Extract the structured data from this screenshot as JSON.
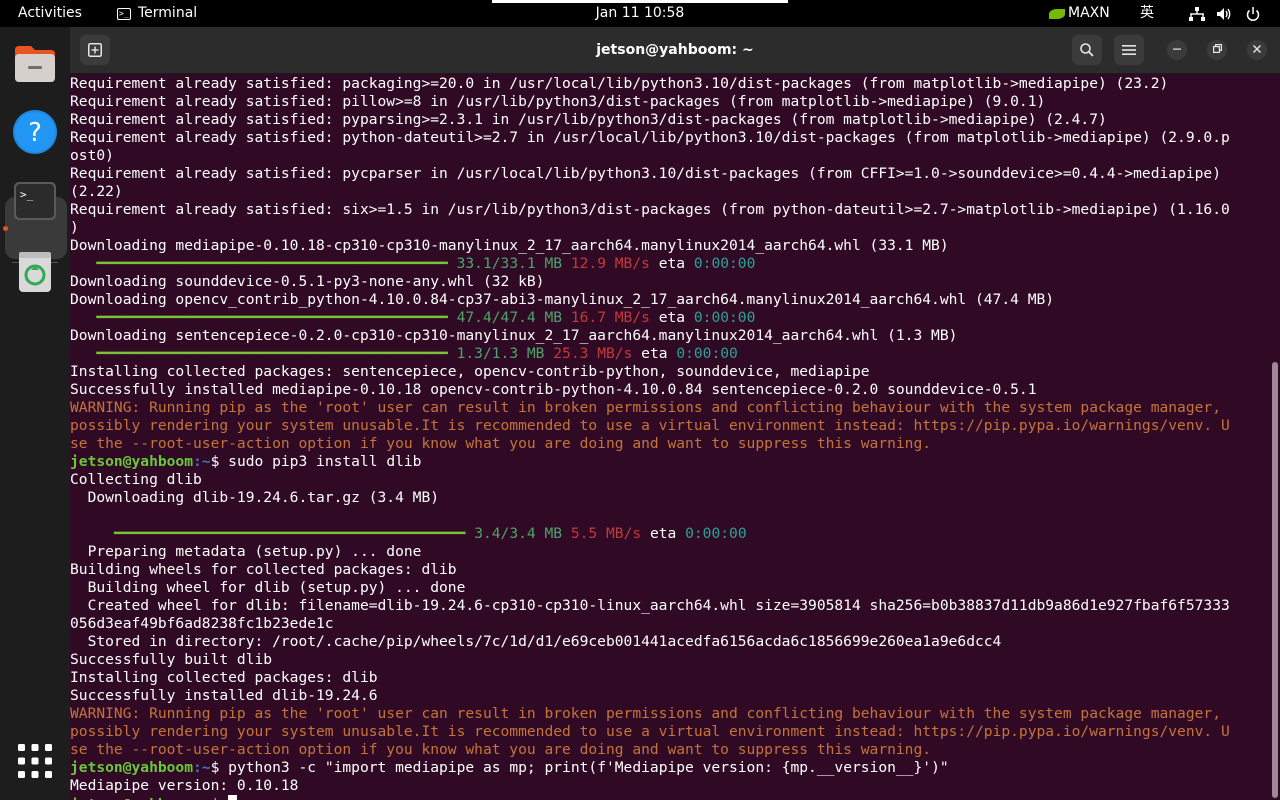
{
  "topbar": {
    "activities": "Activities",
    "app_name": "Terminal",
    "clock": "Jan 11  10:58",
    "power_mode": "MAXN",
    "input_method": "英"
  },
  "dock": {
    "items": [
      "files-icon",
      "help-icon",
      "terminal-icon",
      "trash-icon",
      "app-grid-icon"
    ]
  },
  "window": {
    "title": "jetson@yahboom: ~"
  },
  "terminal": {
    "lines": [
      {
        "t": "Requirement already satisfied: packaging>=20.0 in /usr/local/lib/python3.10/dist-packages (from matplotlib->mediapipe) (23.2)"
      },
      {
        "t": "Requirement already satisfied: pillow>=8 in /usr/lib/python3/dist-packages (from matplotlib->mediapipe) (9.0.1)"
      },
      {
        "t": "Requirement already satisfied: pyparsing>=2.3.1 in /usr/lib/python3/dist-packages (from matplotlib->mediapipe) (2.4.7)"
      },
      {
        "t": "Requirement already satisfied: python-dateutil>=2.7 in /usr/local/lib/python3.10/dist-packages (from matplotlib->mediapipe) (2.9.0.p"
      },
      {
        "t": "ost0)"
      },
      {
        "t": "Requirement already satisfied: pycparser in /usr/local/lib/python3.10/dist-packages (from CFFI>=1.0->sounddevice>=0.4.4->mediapipe)"
      },
      {
        "t": "(2.22)"
      },
      {
        "t": "Requirement already satisfied: six>=1.5 in /usr/lib/python3/dist-packages (from python-dateutil>=2.7->matplotlib->mediapipe) (1.16.0"
      },
      {
        "t": ")"
      },
      {
        "t": "Downloading mediapipe-0.10.18-cp310-cp310-manylinux_2_17_aarch64.manylinux2014_aarch64.whl (33.1 MB)"
      },
      {
        "progress": {
          "indent": "   ",
          "size": "33.1/33.1 MB",
          "speed": "12.9 MB/s",
          "eta_label": "eta",
          "eta": "0:00:00"
        }
      },
      {
        "t": "Downloading sounddevice-0.5.1-py3-none-any.whl (32 kB)"
      },
      {
        "t": "Downloading opencv_contrib_python-4.10.0.84-cp37-abi3-manylinux_2_17_aarch64.manylinux2014_aarch64.whl (47.4 MB)"
      },
      {
        "progress": {
          "indent": "   ",
          "size": "47.4/47.4 MB",
          "speed": "16.7 MB/s",
          "eta_label": "eta",
          "eta": "0:00:00"
        }
      },
      {
        "t": "Downloading sentencepiece-0.2.0-cp310-cp310-manylinux_2_17_aarch64.manylinux2014_aarch64.whl (1.3 MB)"
      },
      {
        "progress": {
          "indent": "   ",
          "size": "1.3/1.3 MB",
          "speed": "25.3 MB/s",
          "eta_label": "eta",
          "eta": "0:00:00"
        }
      },
      {
        "t": "Installing collected packages: sentencepiece, opencv-contrib-python, sounddevice, mediapipe"
      },
      {
        "t": "Successfully installed mediapipe-0.10.18 opencv-contrib-python-4.10.0.84 sentencepiece-0.2.0 sounddevice-0.5.1"
      },
      {
        "w": "WARNING: Running pip as the 'root' user can result in broken permissions and conflicting behaviour with the system package manager,"
      },
      {
        "w": "possibly rendering your system unusable.It is recommended to use a virtual environment instead: https://pip.pypa.io/warnings/venv. U"
      },
      {
        "w": "se the --root-user-action option if you know what you are doing and want to suppress this warning."
      },
      {
        "prompt": {
          "user": "jetson@yahboom",
          "path": ":~",
          "sym": "$ ",
          "cmd": "sudo pip3 install dlib"
        }
      },
      {
        "t": "Collecting dlib"
      },
      {
        "t": "  Downloading dlib-19.24.6.tar.gz (3.4 MB)"
      },
      {
        "t": ""
      },
      {
        "progress": {
          "indent": "     ",
          "size": "3.4/3.4 MB",
          "speed": "5.5 MB/s",
          "eta_label": "eta",
          "eta": "0:00:00"
        }
      },
      {
        "t": "  Preparing metadata (setup.py) ... done"
      },
      {
        "t": "Building wheels for collected packages: dlib"
      },
      {
        "t": "  Building wheel for dlib (setup.py) ... done"
      },
      {
        "t": "  Created wheel for dlib: filename=dlib-19.24.6-cp310-cp310-linux_aarch64.whl size=3905814 sha256=b0b38837d11db9a86d1e927fbaf6f57333"
      },
      {
        "t": "056d3eaf49bf6ad8238fc1b23ede1c"
      },
      {
        "t": "  Stored in directory: /root/.cache/pip/wheels/7c/1d/d1/e69ceb001441acedfa6156acda6c1856699e260ea1a9e6dcc4"
      },
      {
        "t": "Successfully built dlib"
      },
      {
        "t": "Installing collected packages: dlib"
      },
      {
        "t": "Successfully installed dlib-19.24.6"
      },
      {
        "w": "WARNING: Running pip as the 'root' user can result in broken permissions and conflicting behaviour with the system package manager,"
      },
      {
        "w": "possibly rendering your system unusable.It is recommended to use a virtual environment instead: https://pip.pypa.io/warnings/venv. U"
      },
      {
        "w": "se the --root-user-action option if you know what you are doing and want to suppress this warning."
      },
      {
        "prompt": {
          "user": "jetson@yahboom",
          "path": ":~",
          "sym": "$ ",
          "cmd": "python3 -c \"import mediapipe as mp; print(f'Mediapipe version: {mp.__version__}')\""
        }
      },
      {
        "t": "Mediapipe version: 0.10.18"
      },
      {
        "prompt": {
          "user": "jetson@yahboom",
          "path": ":~",
          "sym": "$ ",
          "cmd": "",
          "cursor": true
        }
      }
    ]
  },
  "colors": {
    "terminal_bg": "#300a24",
    "prompt_user": "#69c93a",
    "prompt_path": "#3f73c8",
    "warning": "#c4743a",
    "progress_bar": "#7ac13a",
    "speed": "#c43a3a",
    "eta": "#2aa198",
    "accent": "#e95420"
  }
}
